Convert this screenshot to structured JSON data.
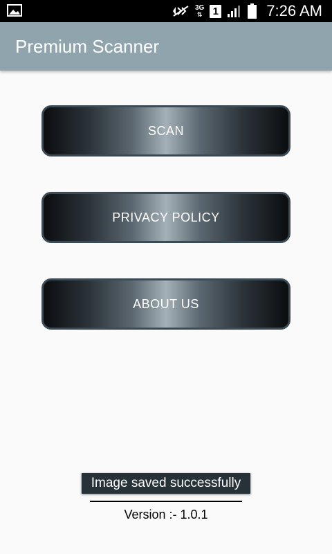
{
  "status_bar": {
    "network": "3G",
    "network_arrows": "⇅",
    "sim_slot": "1",
    "time": "7:26 AM",
    "icons": [
      "image-notification-icon",
      "mute-icon",
      "3g-icon",
      "sim-icon",
      "signal-icon",
      "battery-icon"
    ]
  },
  "app_bar": {
    "title": "Premium Scanner",
    "color": "#90a4ae"
  },
  "menu": {
    "scan_label": "SCAN",
    "privacy_label": "PRIVACY POLICY",
    "about_label": "ABOUT US"
  },
  "toast": {
    "message": "Image saved successfully"
  },
  "footer": {
    "version": "Version :- 1.0.1"
  }
}
